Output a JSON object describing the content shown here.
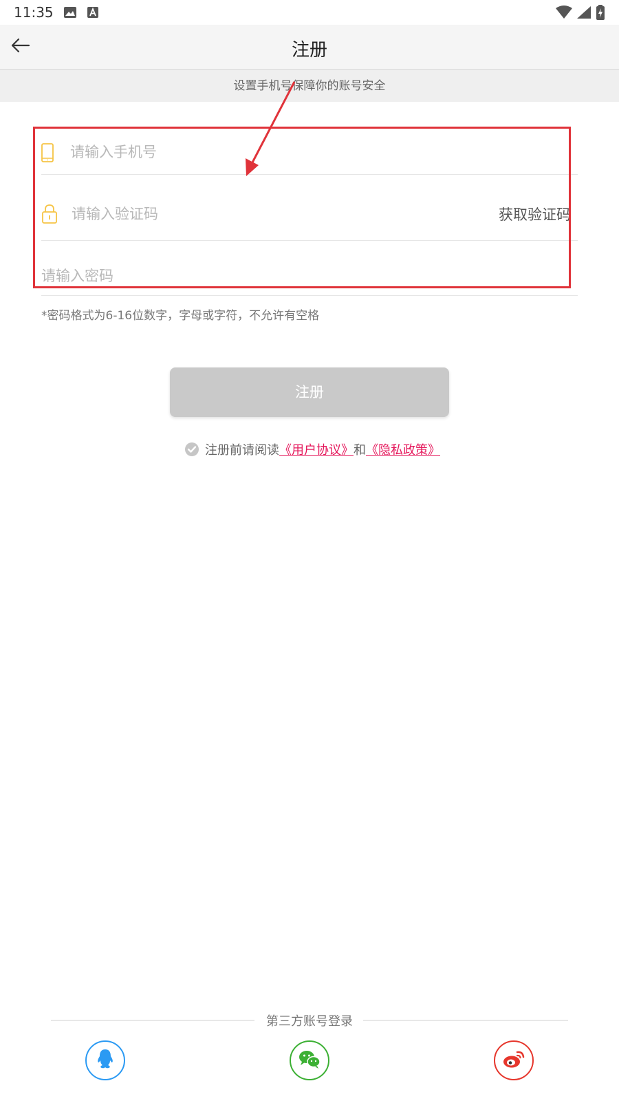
{
  "status_bar": {
    "time": "11:35",
    "icons": [
      "image-icon",
      "a-icon",
      "wifi-icon",
      "signal-icon",
      "battery-icon"
    ]
  },
  "header": {
    "title": "注册",
    "back_icon": "arrow-left-icon"
  },
  "notice": "设置手机号保障你的账号安全",
  "form": {
    "phone_placeholder": "请输入手机号",
    "code_placeholder": "请输入验证码",
    "get_code_label": "获取验证码",
    "password_placeholder": "请输入密码",
    "password_hint": "*密码格式为6-16位数字，字母或字符，不允许有空格"
  },
  "register_button": "注册",
  "agreement": {
    "prefix": "注册前请阅读",
    "user_agreement": "《用户协议》",
    "and": "和",
    "privacy_policy": "《隐私政策》"
  },
  "third_party": {
    "label": "第三方账号登录",
    "providers": [
      "qq-icon",
      "wechat-icon",
      "weibo-icon"
    ]
  },
  "colors": {
    "accent_pink": "#e5175b",
    "icon_yellow": "#f6c445",
    "highlight_red": "#e0333a",
    "button_gray": "#c9c9c9",
    "qq_blue": "#2b9af3",
    "wechat_green": "#3cb034",
    "weibo_red": "#e6362c"
  }
}
